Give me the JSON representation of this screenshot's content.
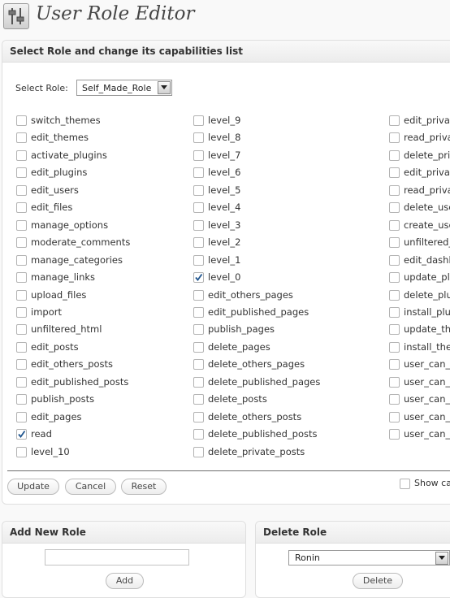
{
  "page": {
    "title": "User Role Editor"
  },
  "main_panel": {
    "heading": "Select Role and change its capabilities list",
    "role_label": "Select Role:",
    "role_selected": "Self_Made_Role",
    "show_caps_label": "Show ca"
  },
  "capabilities": {
    "col1": [
      {
        "label": "switch_themes",
        "checked": false
      },
      {
        "label": "edit_themes",
        "checked": false
      },
      {
        "label": "activate_plugins",
        "checked": false
      },
      {
        "label": "edit_plugins",
        "checked": false
      },
      {
        "label": "edit_users",
        "checked": false
      },
      {
        "label": "edit_files",
        "checked": false
      },
      {
        "label": "manage_options",
        "checked": false
      },
      {
        "label": "moderate_comments",
        "checked": false
      },
      {
        "label": "manage_categories",
        "checked": false
      },
      {
        "label": "manage_links",
        "checked": false
      },
      {
        "label": "upload_files",
        "checked": false
      },
      {
        "label": "import",
        "checked": false
      },
      {
        "label": "unfiltered_html",
        "checked": false
      },
      {
        "label": "edit_posts",
        "checked": false
      },
      {
        "label": "edit_others_posts",
        "checked": false
      },
      {
        "label": "edit_published_posts",
        "checked": false
      },
      {
        "label": "publish_posts",
        "checked": false
      },
      {
        "label": "edit_pages",
        "checked": false
      },
      {
        "label": "read",
        "checked": true
      },
      {
        "label": "level_10",
        "checked": false
      }
    ],
    "col2": [
      {
        "label": "level_9",
        "checked": false
      },
      {
        "label": "level_8",
        "checked": false
      },
      {
        "label": "level_7",
        "checked": false
      },
      {
        "label": "level_6",
        "checked": false
      },
      {
        "label": "level_5",
        "checked": false
      },
      {
        "label": "level_4",
        "checked": false
      },
      {
        "label": "level_3",
        "checked": false
      },
      {
        "label": "level_2",
        "checked": false
      },
      {
        "label": "level_1",
        "checked": false
      },
      {
        "label": "level_0",
        "checked": true
      },
      {
        "label": "edit_others_pages",
        "checked": false
      },
      {
        "label": "edit_published_pages",
        "checked": false
      },
      {
        "label": "publish_pages",
        "checked": false
      },
      {
        "label": "delete_pages",
        "checked": false
      },
      {
        "label": "delete_others_pages",
        "checked": false
      },
      {
        "label": "delete_published_pages",
        "checked": false
      },
      {
        "label": "delete_posts",
        "checked": false
      },
      {
        "label": "delete_others_posts",
        "checked": false
      },
      {
        "label": "delete_published_posts",
        "checked": false
      },
      {
        "label": "delete_private_posts",
        "checked": false
      }
    ],
    "col3": [
      {
        "label": "edit_privat",
        "checked": false
      },
      {
        "label": "read_priva",
        "checked": false
      },
      {
        "label": "delete_pri",
        "checked": false
      },
      {
        "label": "edit_privat",
        "checked": false
      },
      {
        "label": "read_priva",
        "checked": false
      },
      {
        "label": "delete_use",
        "checked": false
      },
      {
        "label": "create_use",
        "checked": false
      },
      {
        "label": "unfiltered_",
        "checked": false
      },
      {
        "label": "edit_dashb",
        "checked": false
      },
      {
        "label": "update_plu",
        "checked": false
      },
      {
        "label": "delete_plu",
        "checked": false
      },
      {
        "label": "install_plu",
        "checked": false
      },
      {
        "label": "update_the",
        "checked": false
      },
      {
        "label": "install_the",
        "checked": false
      },
      {
        "label": "user_can_",
        "checked": false
      },
      {
        "label": "user_can_",
        "checked": false
      },
      {
        "label": "user_can_",
        "checked": false
      },
      {
        "label": "user_can_",
        "checked": false
      },
      {
        "label": "user_can_",
        "checked": false
      }
    ]
  },
  "buttons": {
    "update": "Update",
    "cancel": "Cancel",
    "reset": "Reset"
  },
  "add_role": {
    "heading": "Add New Role",
    "input_value": "",
    "button": "Add"
  },
  "delete_role": {
    "heading": "Delete Role",
    "selected": "Ronin",
    "button": "Delete"
  },
  "icons": [
    "settings-sliders-icon",
    "checkbox-check-icon",
    "dropdown-arrow-icon"
  ]
}
